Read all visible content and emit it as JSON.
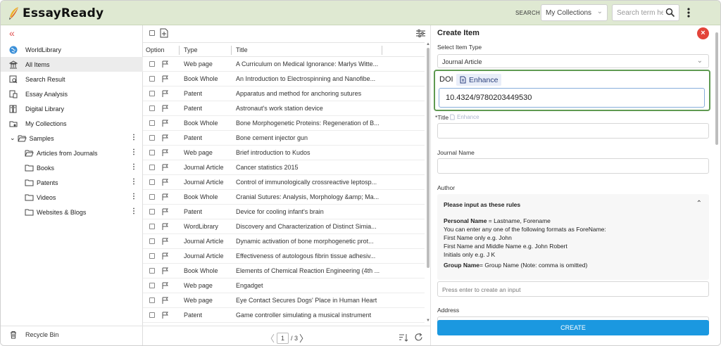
{
  "app": {
    "name": "EssayReady"
  },
  "header": {
    "search_label": "SEARCH",
    "collection_select": "My Collections",
    "search_placeholder": "Search term here"
  },
  "sidebar": {
    "items": [
      {
        "label": "WorldLibrary",
        "icon": "globe-icon"
      },
      {
        "label": "All Items",
        "icon": "library-icon",
        "active": true
      },
      {
        "label": "Search Result",
        "icon": "search-result-icon"
      },
      {
        "label": "Essay Analysis",
        "icon": "essay-analysis-icon"
      },
      {
        "label": "Digital Library",
        "icon": "digital-library-icon"
      },
      {
        "label": "My Collections",
        "icon": "collections-icon"
      }
    ],
    "group": {
      "label": "Samples"
    },
    "sub_items": [
      {
        "label": "Articles from Journals"
      },
      {
        "label": "Books"
      },
      {
        "label": "Patents"
      },
      {
        "label": "Videos"
      },
      {
        "label": "Websites & Blogs"
      }
    ],
    "recycle": "Recycle Bin"
  },
  "list": {
    "columns": {
      "option": "Option",
      "type": "Type",
      "title": "Title"
    },
    "rows": [
      {
        "type": "Web page",
        "title": "A Curriculum on Medical Ignorance: Marlys Witte..."
      },
      {
        "type": "Book Whole",
        "title": "An Introduction to Electrospinning and Nanofibe..."
      },
      {
        "type": "Patent",
        "title": "Apparatus and method for anchoring sutures"
      },
      {
        "type": "Patent",
        "title": "Astronaut's work station device"
      },
      {
        "type": "Book Whole",
        "title": "Bone Morphogenetic Proteins: Regeneration of B..."
      },
      {
        "type": "Patent",
        "title": "Bone cement injector gun"
      },
      {
        "type": "Web page",
        "title": "Brief introduction to Kudos"
      },
      {
        "type": "Journal Article",
        "title": "Cancer statistics 2015"
      },
      {
        "type": "Journal Article",
        "title": "Control of immunologically crossreactive leptosp..."
      },
      {
        "type": "Book Whole",
        "title": "Cranial Sutures: Analysis, Morphology &amp; Ma..."
      },
      {
        "type": "Patent",
        "title": "Device for cooling infant's brain"
      },
      {
        "type": "WordLibrary",
        "title": "Discovery and Characterization of Distinct Simia..."
      },
      {
        "type": "Journal Article",
        "title": "Dynamic activation of bone morphogenetic prot..."
      },
      {
        "type": "Journal Article",
        "title": "Effectiveness of autologous fibrin tissue adhesiv..."
      },
      {
        "type": "Book Whole",
        "title": "Elements of Chemical Reaction Engineering (4th ..."
      },
      {
        "type": "Web page",
        "title": "Engadget"
      },
      {
        "type": "Web page",
        "title": "Eye Contact Secures Dogs' Place in Human Heart"
      },
      {
        "type": "Patent",
        "title": "Game controller simulating a musical instrument"
      }
    ],
    "pager": {
      "current": "1",
      "total": "/ 3"
    }
  },
  "panel": {
    "title": "Create Item",
    "select_type_label": "Select Item Type",
    "select_type_value": "Journal Article",
    "doi_label": "DOI",
    "enhance": "Enhance",
    "doi_value": "10.4324/9780203449530",
    "title_label": "*Title",
    "journal_label": "Journal Name",
    "author_label": "Author",
    "rules": {
      "heading": "Please input as these rules",
      "personal_bold": "Personal Name",
      "personal_rest": " = Lastname, Forename",
      "l1": "You can enter any one of the following formats as ForeName:",
      "l2": "First Name only e.g. John",
      "l3": "First Name and Middle Name e.g. John Robert",
      "l4": "Initials only e.g. J K",
      "group_bold": "Group Name",
      "group_rest": "= Group Name (Note: comma is omitted)"
    },
    "author_placeholder": "Press enter to create an input",
    "address_label": "Address",
    "create_button": "CREATE"
  },
  "colors": {
    "header_bg": "#dfe9d2",
    "accent_green": "#5f9a52",
    "create_blue": "#1b98e0",
    "close_red": "#e3443a"
  }
}
